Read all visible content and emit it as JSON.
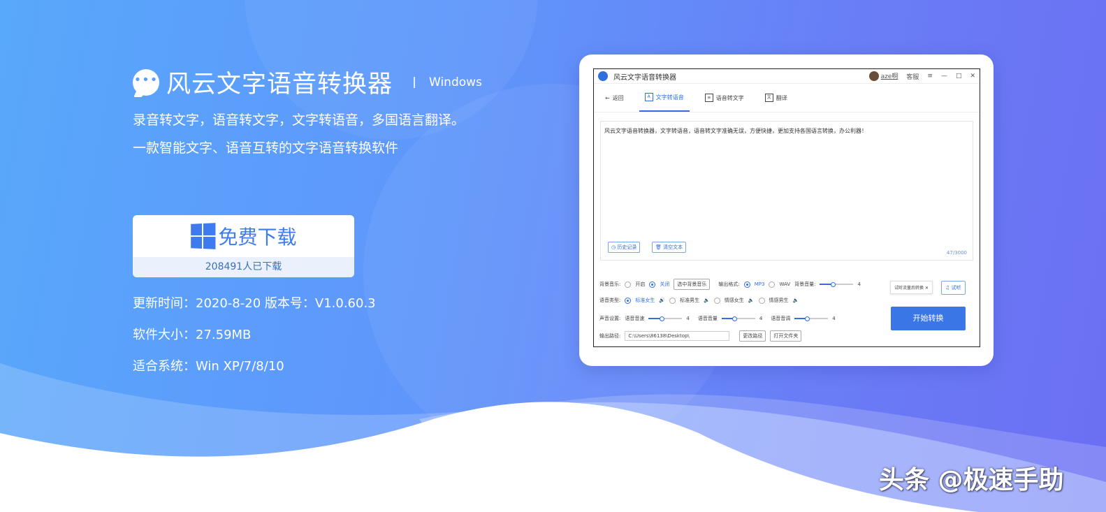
{
  "brand": {
    "name": "风云文字语音转换器",
    "platform": "Windows",
    "logo_icon": "chat-bubble-icon"
  },
  "taglines": [
    "录音转文字，语音转文字，文字转语音，多国语言翻译。",
    "一款智能文字、语音互转的文字语音转换软件"
  ],
  "download": {
    "label": "免费下载",
    "count_text": "208491人已下载",
    "icon": "windows-icon"
  },
  "meta": [
    "更新时间：2020-8-20 版本号：V1.0.60.3",
    "软件大小：27.59MB",
    "适合系统：Win XP/7/8/10"
  ],
  "app": {
    "title": "风云文字语音转换器",
    "user": "aze啊",
    "service": "客服",
    "win_controls": [
      "≡",
      "—",
      "□",
      "✕"
    ],
    "back": "返回",
    "tabs": [
      {
        "label": "文字转语音",
        "icon": "text-to-speech-icon",
        "active": true
      },
      {
        "label": "语音转文字",
        "icon": "speech-to-text-icon",
        "active": false
      },
      {
        "label": "翻译",
        "icon": "translate-icon",
        "active": false
      }
    ],
    "editor_text": "风云文字语音转换器，文字转语音，语音转文字准确无误，方便快捷，更加支持各国语言转换，办公利器！",
    "history_btn": "历史记录",
    "clear_btn": "清空文本",
    "char_count": "47/3000",
    "bg_music": {
      "label": "背景音乐:",
      "on": "开启",
      "off": "关闭",
      "select": "选中背景音乐"
    },
    "output_format": {
      "label": "输出格式:",
      "mp3": "MP3",
      "wav": "WAV"
    },
    "bg_volume": {
      "label": "背景音量:",
      "value": "4"
    },
    "voice_type": {
      "label": "语音类型:",
      "options": [
        "标准女生",
        "标准男生",
        "情感女生",
        "情感男生"
      ]
    },
    "sound": {
      "label": "声音设置:",
      "speed_label": "语音音速",
      "speed": "4",
      "vol_label": "语音音量",
      "vol": "4",
      "pitch_label": "语音音调",
      "pitch": "4"
    },
    "output_path": {
      "label": "输出路径:",
      "value": "C:\\Users\\86138\\Desktop\\",
      "change": "更改路径",
      "open": "打开文件夹"
    },
    "try_input": "试听流量后转换",
    "try_btn": "试听",
    "start_btn": "开始转换"
  },
  "watermark": "头条 @极速手助",
  "colors": {
    "accent": "#3d7bef",
    "bg_start": "#58a8fb",
    "bg_end": "#6b6ff3"
  }
}
